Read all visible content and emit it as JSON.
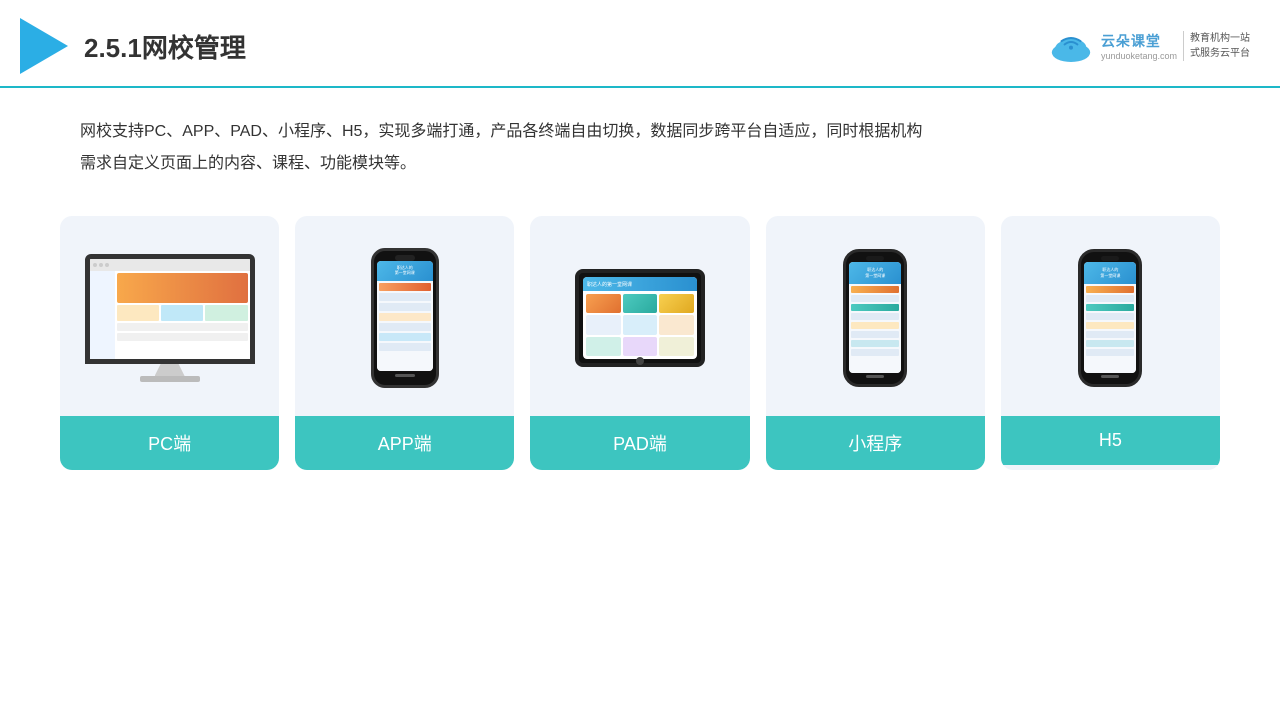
{
  "header": {
    "title": "2.5.1网校管理",
    "brand_name": "云朵课堂",
    "brand_domain": "yunduoketang.com",
    "brand_slogan": "教育机构一站\n式服务云平台"
  },
  "description": {
    "line1": "网校支持PC、APP、PAD、小程序、H5，实现多端打通，产品各终端自由切换，数据同步跨平台自适应，同时根据机构",
    "line2": "需求自定义页面上的内容、课程、功能模块等。"
  },
  "cards": [
    {
      "id": "pc",
      "label": "PC端"
    },
    {
      "id": "app",
      "label": "APP端"
    },
    {
      "id": "pad",
      "label": "PAD端"
    },
    {
      "id": "miniprogram",
      "label": "小程序"
    },
    {
      "id": "h5",
      "label": "H5"
    }
  ]
}
